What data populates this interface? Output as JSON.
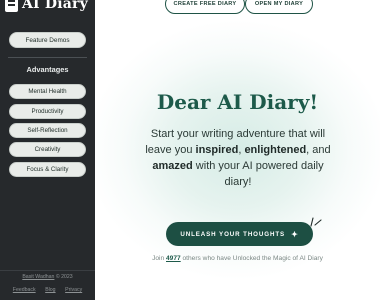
{
  "sidebar": {
    "brand": "AI Diary",
    "feature_demos": "Feature Demos",
    "heading": "Advantages",
    "items": [
      {
        "label": "Mental Health"
      },
      {
        "label": "Productivity"
      },
      {
        "label": "Self-Reflection"
      },
      {
        "label": "Creativity"
      },
      {
        "label": "Focus & Clarity"
      }
    ],
    "footer": {
      "copyright_link": "Basit Wadhan",
      "copyright_rest": " © 2023",
      "links": [
        "Feedback",
        "Blog",
        "Privacy"
      ]
    }
  },
  "header": {
    "create_label": "CREATE FREE DIARY",
    "open_label": "OPEN MY DIARY"
  },
  "hero": {
    "title": "Dear AI Diary!",
    "tagline_1": "Start your writing adventure that will leave you ",
    "tagline_inspired": "inspired",
    "tagline_2": ", ",
    "tagline_enlightened": "enlightened",
    "tagline_3": ", and ",
    "tagline_amazed": "amazed",
    "tagline_4": " with your AI powered daily diary!",
    "cta_label": "UNLEASH YOUR THOUGHTS",
    "join_prefix": "Join ",
    "join_count": "4977",
    "join_suffix": " others who have Unlocked the Magic of AI Diary"
  },
  "colors": {
    "sidebar_bg": "#26292c",
    "accent": "#1d4f43",
    "title": "#1d5a4a"
  },
  "icons": [
    "book-logo-icon",
    "sparkle-icon"
  ]
}
